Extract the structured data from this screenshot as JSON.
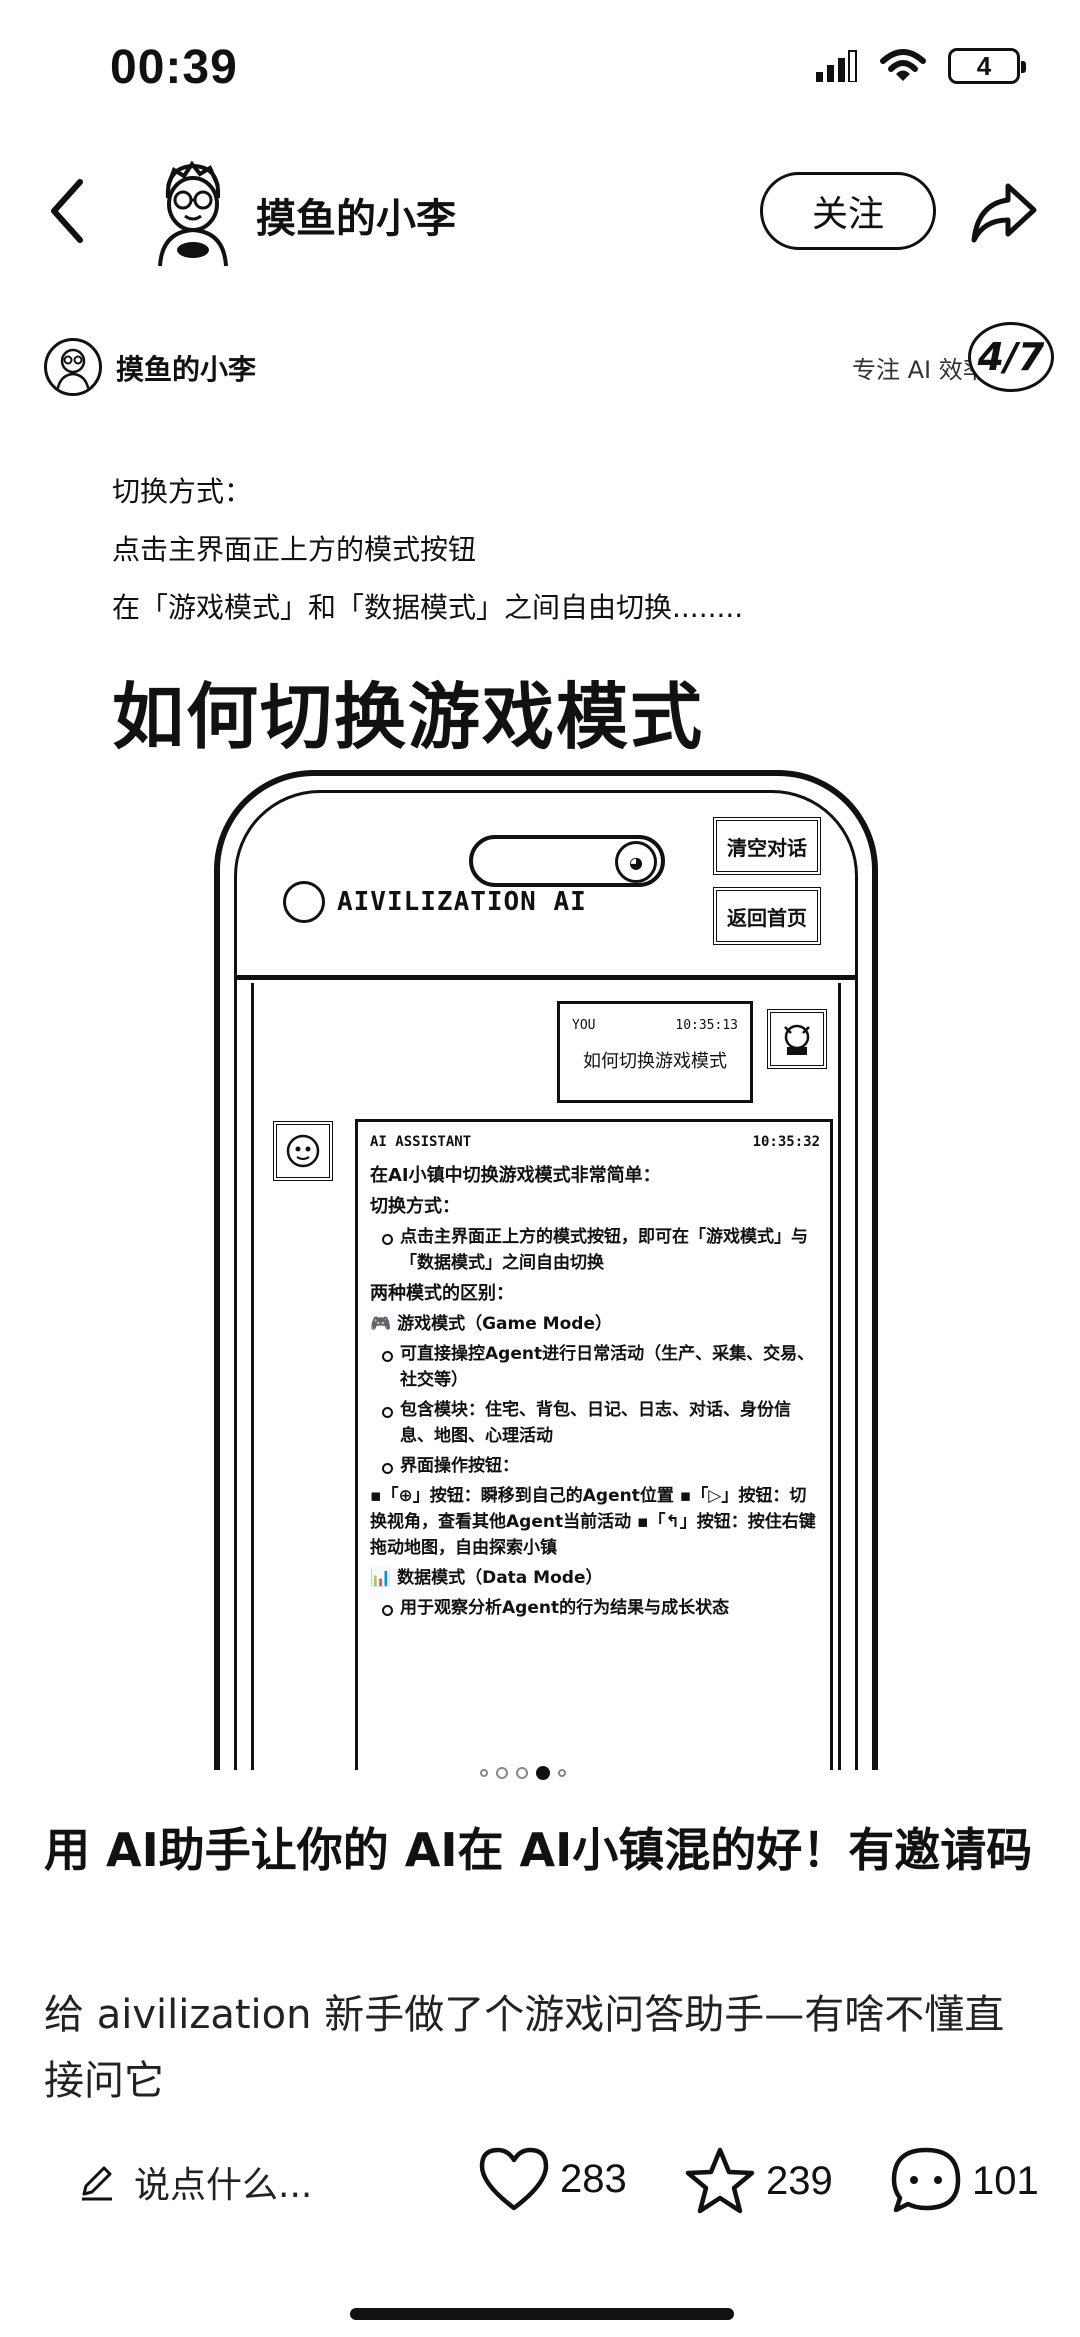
{
  "status_bar": {
    "time": "00:39",
    "battery": "4"
  },
  "header": {
    "author": "摸鱼的小李",
    "follow_label": "关注"
  },
  "post_header": {
    "author": "摸鱼的小李",
    "slogan": "专注 AI 效率",
    "page_badge": "4/7"
  },
  "description": [
    "切换方式：",
    "点击主界面正上方的模式按钮",
    "在「游戏模式」和「数据模式」之间自由切换........"
  ],
  "heading": "如何切换游戏模式",
  "phone": {
    "app_title": "AIVILIZATION AI",
    "clear_btn": "清空对话",
    "home_btn": "返回首页",
    "user_msg": {
      "sender": "YOU",
      "time": "10:35:13",
      "text": "如何切换游戏模式"
    },
    "bot_msg": {
      "sender": "AI ASSISTANT",
      "time": "10:35:32",
      "lines": [
        "在AI小镇中切换游戏模式非常简单：",
        "切换方式：",
        "点击主界面正上方的模式按钮，即可在「游戏模式」与「数据模式」之间自由切换",
        "两种模式的区别：",
        "🎮 游戏模式（Game Mode）",
        "可直接操控Agent进行日常活动（生产、采集、交易、社交等）",
        "包含模块：住宅、背包、日记、日志、对话、身份信息、地图、心理活动",
        "界面操作按钮：",
        "▪「⊕」按钮：瞬移到自己的Agent位置 ▪「▷」按钮：切换视角，查看其他Agent当前活动 ▪「↰」按钮：按住右键拖动地图，自由探索小镇",
        "📊 数据模式（Data Mode）",
        "用于观察分析Agent的行为结果与成长状态"
      ]
    }
  },
  "carousel": {
    "count": 5,
    "active": 3
  },
  "post": {
    "title": "用 AI助手让你的 AI在 AI小镇混的好！有邀请码",
    "body": "给 aivilization 新手做了个游戏问答助手—有啥不懂直接问它"
  },
  "actions": {
    "comment_placeholder": "说点什么...",
    "likes": "283",
    "favorites": "239",
    "comments": "101"
  }
}
